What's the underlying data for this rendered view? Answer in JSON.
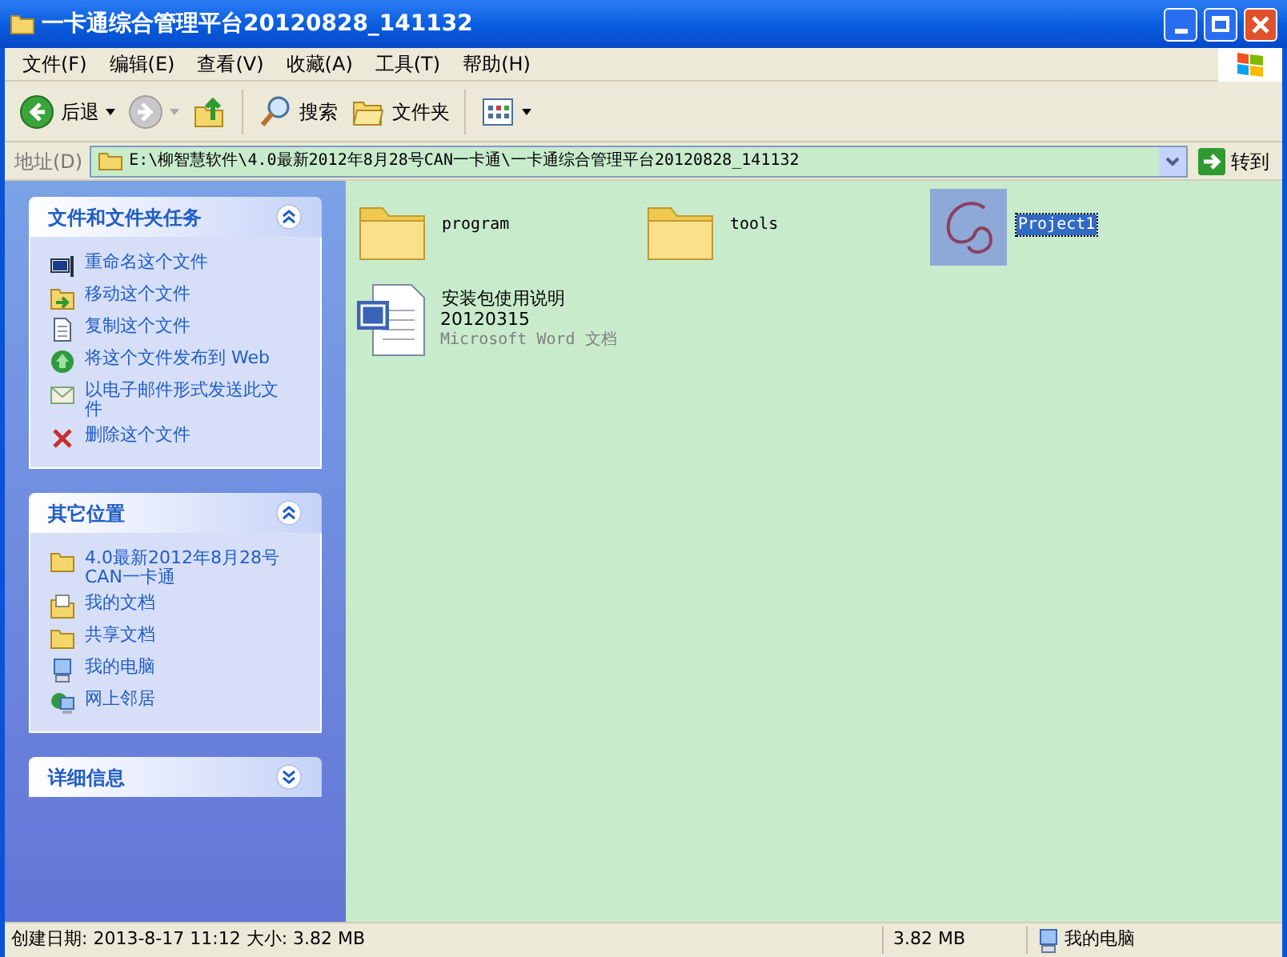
{
  "window": {
    "title": "一卡通综合管理平台20120828_141132"
  },
  "menu": [
    "文件(F)",
    "编辑(E)",
    "查看(V)",
    "收藏(A)",
    "工具(T)",
    "帮助(H)"
  ],
  "toolbar": [
    {
      "kind": "back",
      "label": "后退",
      "disabled": false
    },
    {
      "kind": "forward",
      "disabled": true
    },
    {
      "kind": "up",
      "disabled": false
    },
    {
      "kind": "search",
      "label": "搜索",
      "disabled": false
    },
    {
      "kind": "folders",
      "label": "文件夹",
      "disabled": false
    },
    {
      "kind": "views",
      "disabled": false
    }
  ],
  "address_bar": {
    "label": "地址(D)",
    "value": "E:\\柳智慧软件\\4.0最新2012年8月28号CAN一卡通\\一卡通综合管理平台20120828_141132",
    "go": "转到"
  },
  "sidebar": [
    {
      "title": "文件和文件夹任务",
      "expanded": true,
      "items": [
        {
          "kind": "rename",
          "label": "重命名这个文件"
        },
        {
          "kind": "move",
          "label": "移动这个文件"
        },
        {
          "kind": "copy",
          "label": "复制这个文件"
        },
        {
          "kind": "web",
          "label": "将这个文件发布到 Web"
        },
        {
          "kind": "mail",
          "label": "以电子邮件形式发送此文件"
        },
        {
          "kind": "delete",
          "label": "删除这个文件"
        }
      ]
    },
    {
      "title": "其它位置",
      "expanded": true,
      "items": [
        {
          "kind": "folder",
          "label": "4.0最新2012年8月28号CAN一卡通"
        },
        {
          "kind": "documents",
          "label": "我的文档"
        },
        {
          "kind": "folder",
          "label": "共享文档"
        },
        {
          "kind": "computer",
          "label": "我的电脑"
        },
        {
          "kind": "network",
          "label": "网上邻居"
        }
      ]
    },
    {
      "title": "详细信息",
      "expanded": false
    }
  ],
  "files": [
    {
      "kind": "folder",
      "name": "program",
      "selected": false
    },
    {
      "kind": "folder",
      "name": "tools",
      "selected": false
    },
    {
      "kind": "app",
      "name": "Project1",
      "selected": true
    },
    {
      "kind": "doc",
      "name": "安装包使用说明",
      "date": "20120315",
      "type": "Microsoft Word 文档",
      "selected": false
    }
  ],
  "status_bar": {
    "info": "创建日期: 2013-8-17 11:12 大小: 3.82 MB",
    "size": "3.82 MB",
    "location": "我的电脑"
  }
}
